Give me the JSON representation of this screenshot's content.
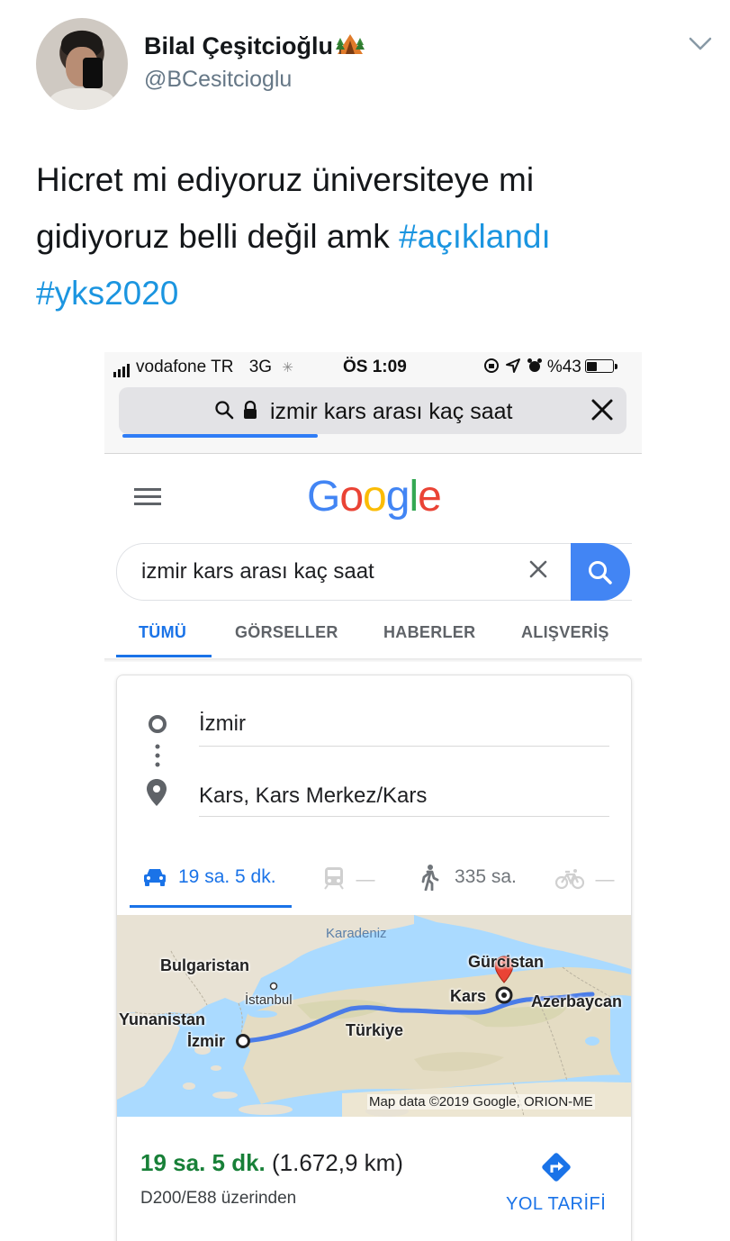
{
  "tweet": {
    "display_name": "Bilal Çeşitcioğlu",
    "name_emoji": "tent-icon",
    "handle": "@BCesitcioglu",
    "text_line1": "Hicret mi ediyoruz üniversiteye mi",
    "text_line2": "gidiyoruz belli değil amk ",
    "hashtag1": "#açıklandı",
    "hashtag2": "#yks2020",
    "link_color": "#1b95e0"
  },
  "phone": {
    "status": {
      "carrier": "vodafone TR",
      "network": "3G",
      "time": "ÖS 1:09",
      "battery": "%43"
    },
    "address_bar": {
      "query": "izmir kars arası kaç saat"
    }
  },
  "google": {
    "logo_letters": [
      "G",
      "o",
      "o",
      "g",
      "l",
      "e"
    ],
    "search_value": "izmir kars arası kaç saat",
    "tabs": [
      {
        "label": "TÜMÜ",
        "active": true
      },
      {
        "label": "GÖRSELLER",
        "active": false
      },
      {
        "label": "HABERLER",
        "active": false
      },
      {
        "label": "ALIŞVERİŞ",
        "active": false
      }
    ],
    "accent_color": "#1a73e8"
  },
  "directions": {
    "origin": "İzmir",
    "destination": "Kars, Kars Merkez/Kars",
    "modes": {
      "car": "19 sa. 5 dk.",
      "train": "—",
      "walk": "335 sa.",
      "bike": "—"
    },
    "map": {
      "labels": {
        "sea": "Karadeniz",
        "bulgaria": "Bulgaristan",
        "istanbul": "İstanbul",
        "greece": "Yunanistan",
        "izmir": "İzmir",
        "turkey": "Türkiye",
        "georgia": "Gürcistan",
        "kars": "Kars",
        "azerbaijan": "Azerbaycan"
      },
      "attribution": "Map data ©2019 Google, ORION-ME"
    },
    "summary": {
      "duration": "19 sa. 5 dk.",
      "distance": "(1.672,9 km)",
      "via": "D200/E88 üzerinden",
      "directions_label": "YOL TARİFİ"
    }
  }
}
